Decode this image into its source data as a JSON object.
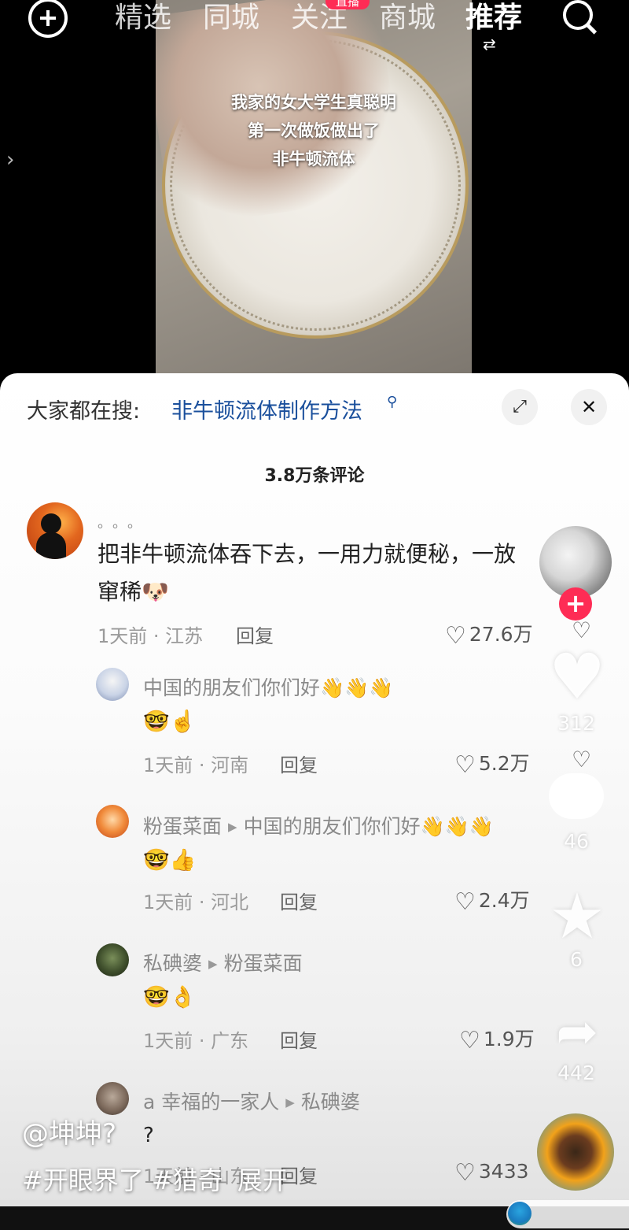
{
  "video": {
    "caption_lines": [
      "我家的女大学生真聪明",
      "第一次做饭做出了",
      "非牛顿流体"
    ]
  },
  "topnav": {
    "tabs": [
      "精选",
      "同城",
      "关注",
      "商城",
      "推荐"
    ],
    "active_tab": "推荐",
    "live_badge": "直播",
    "switch_glyph": "⇄"
  },
  "sheet": {
    "search_prefix": "大家都在搜:",
    "search_query": "非牛顿流体制作方法",
    "comment_count": "3.8万条评论"
  },
  "comments": [
    {
      "name": "。。。",
      "text_line1": "把非牛顿流体吞下去，一用力就便秘，一放",
      "text_line2": "窜稀",
      "emoji": "🐶",
      "time": "1天前",
      "location": "江苏",
      "reply": "回复",
      "likes": "27.6万"
    }
  ],
  "replies": [
    {
      "name": "中国的朋友们你们好",
      "name_emoji": "👋👋👋",
      "text": "🤓☝️",
      "time": "1天前",
      "location": "河南",
      "reply": "回复",
      "likes": "5.2万"
    },
    {
      "name": "粉蛋菜面",
      "reply_to": "中国的朋友们你们好",
      "name_emoji": "👋👋👋",
      "text": "🤓👍",
      "time": "1天前",
      "location": "河北",
      "reply": "回复",
      "likes": "2.4万"
    },
    {
      "name": "私碘婆",
      "reply_to": "粉蛋菜面",
      "text": "🤓👌",
      "time": "1天前",
      "location": "广东",
      "reply": "回复",
      "likes": "1.9万"
    },
    {
      "name": "a 幸福的一家人",
      "reply_to": "私碘婆",
      "text": "?",
      "time": "1天前",
      "location": "山东",
      "reply": "回复",
      "likes": "3433"
    }
  ],
  "rail": {
    "like_count": "312",
    "comment_count": "46",
    "favorite_count": "6",
    "share_count": "442"
  },
  "caption": {
    "author": "@坤坤?",
    "tags": "#开眼界了 #猎奇",
    "expand": "展开"
  },
  "icons": {
    "add": "plus-circle-icon",
    "search": "search-icon",
    "expand": "expand-icon",
    "close": "close-icon",
    "heart": "heart-icon",
    "dislike": "broken-heart-icon",
    "comment": "comment-bubble-icon",
    "star": "star-icon",
    "share": "share-arrow-icon"
  },
  "colors": {
    "accent_red": "#fe2c55",
    "link_blue": "#1a4f9c"
  }
}
